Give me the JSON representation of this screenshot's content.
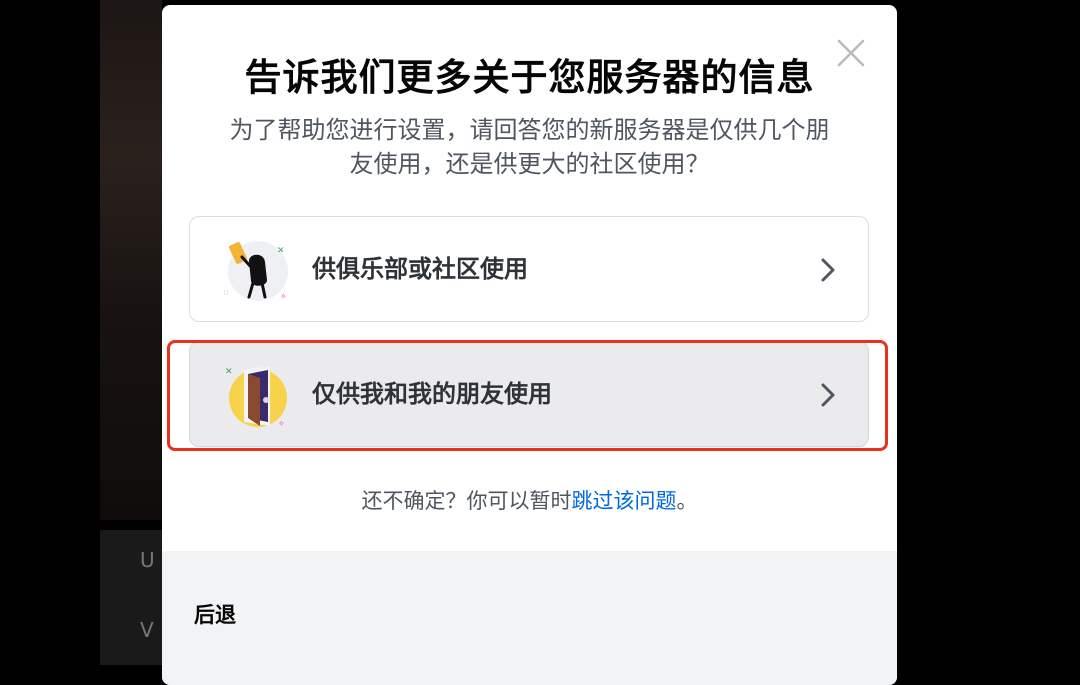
{
  "modal": {
    "title": "告诉我们更多关于您服务器的信息",
    "subtitle_line1": "为了帮助您进行设置，请回答您的新服务器是仅供几个朋",
    "subtitle_line2": "友使用，还是供更大的社区使用？",
    "options": [
      {
        "label": "供俱乐部或社区使用",
        "icon": "club-community-illustration"
      },
      {
        "label": "仅供我和我的朋友使用",
        "icon": "friends-door-illustration"
      }
    ],
    "hint_prefix": "还不确定？你可以暂时",
    "hint_link": "跳过该问题",
    "hint_suffix": "。",
    "back_label": "后退"
  },
  "background": {
    "fragment_top": "U",
    "fragment_bottom": "V"
  },
  "colors": {
    "highlight": "#e8321e",
    "link": "#0068e0",
    "footer": "#f2f3f5"
  }
}
